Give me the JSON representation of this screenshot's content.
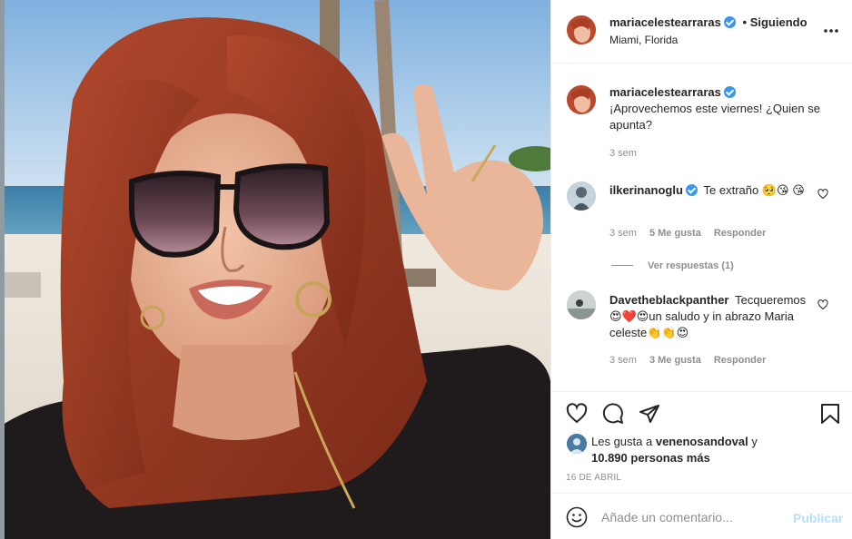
{
  "post": {
    "username": "mariacelestearraras",
    "follow_separator": "•",
    "follow_status": "Siguiendo",
    "location": "Miami, Florida",
    "more_icon": "more-horizontal-icon"
  },
  "caption": {
    "username": "mariacelestearraras",
    "text": "¡Aprovechemos este viernes! ¿Quien se apunta?",
    "time": "3 sem"
  },
  "comments": [
    {
      "username": "ilkerinanoglu",
      "verified": true,
      "text": "Te extraño 🥺😘 😘",
      "time": "3 sem",
      "likes": "5 Me gusta",
      "reply": "Responder",
      "view_replies": "Ver respuestas (1)"
    },
    {
      "username": "Davetheblackpanther",
      "verified": false,
      "text": "Tecqueremos 😍❤️😍un saludo y in abrazo Maria celeste👏👏😍",
      "time": "3 sem",
      "likes": "3 Me gusta",
      "reply": "Responder"
    }
  ],
  "actions": {
    "icons": [
      "heart-icon",
      "comment-icon",
      "share-icon",
      "bookmark-icon"
    ],
    "liked_by_prefix": "Les gusta a",
    "liked_by_user": "venenosandoval",
    "liked_by_conj": "y",
    "liked_by_others": "10.890 personas más",
    "date": "16 DE ABRIL"
  },
  "add_comment": {
    "placeholder": "Añade un comentario...",
    "publish": "Publicar",
    "emoji_icon": "emoji-icon"
  },
  "colors": {
    "link_blue": "#0095f6",
    "publish_disabled": "#b2dffc",
    "verified_blue": "#3897f0",
    "secondary_text": "#8e8e8e"
  }
}
